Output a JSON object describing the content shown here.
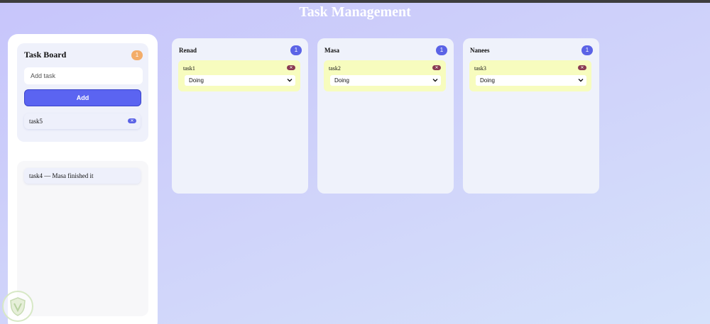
{
  "header": {
    "title": "Task Management"
  },
  "sidebar": {
    "board_title": "Task Board",
    "board_count": "1",
    "add_input_placeholder": "Add task",
    "add_button_label": "Add",
    "pending_tasks": [
      {
        "label": "task5",
        "remove_symbol": "✕"
      }
    ],
    "done_items": [
      {
        "label": "task4 — Masa finished it"
      }
    ]
  },
  "columns": [
    {
      "name": "Renad",
      "count": "1",
      "task": {
        "label": "task1",
        "status": "Doing",
        "remove_symbol": "✕"
      }
    },
    {
      "name": "Masa",
      "count": "1",
      "task": {
        "label": "task2",
        "status": "Doing",
        "remove_symbol": "✕"
      }
    },
    {
      "name": "Nanees",
      "count": "1",
      "task": {
        "label": "task3",
        "status": "Doing",
        "remove_symbol": "✕"
      }
    }
  ],
  "icons": {
    "remove": "close-icon",
    "dropdown": "chevron-down-icon",
    "watermark": "shield-logo-icon"
  },
  "colors": {
    "accent": "#5b64f1",
    "board_badge": "#f3ad6a",
    "task_card": "#f7fcbe",
    "remove_pill": "#8a3a52"
  }
}
